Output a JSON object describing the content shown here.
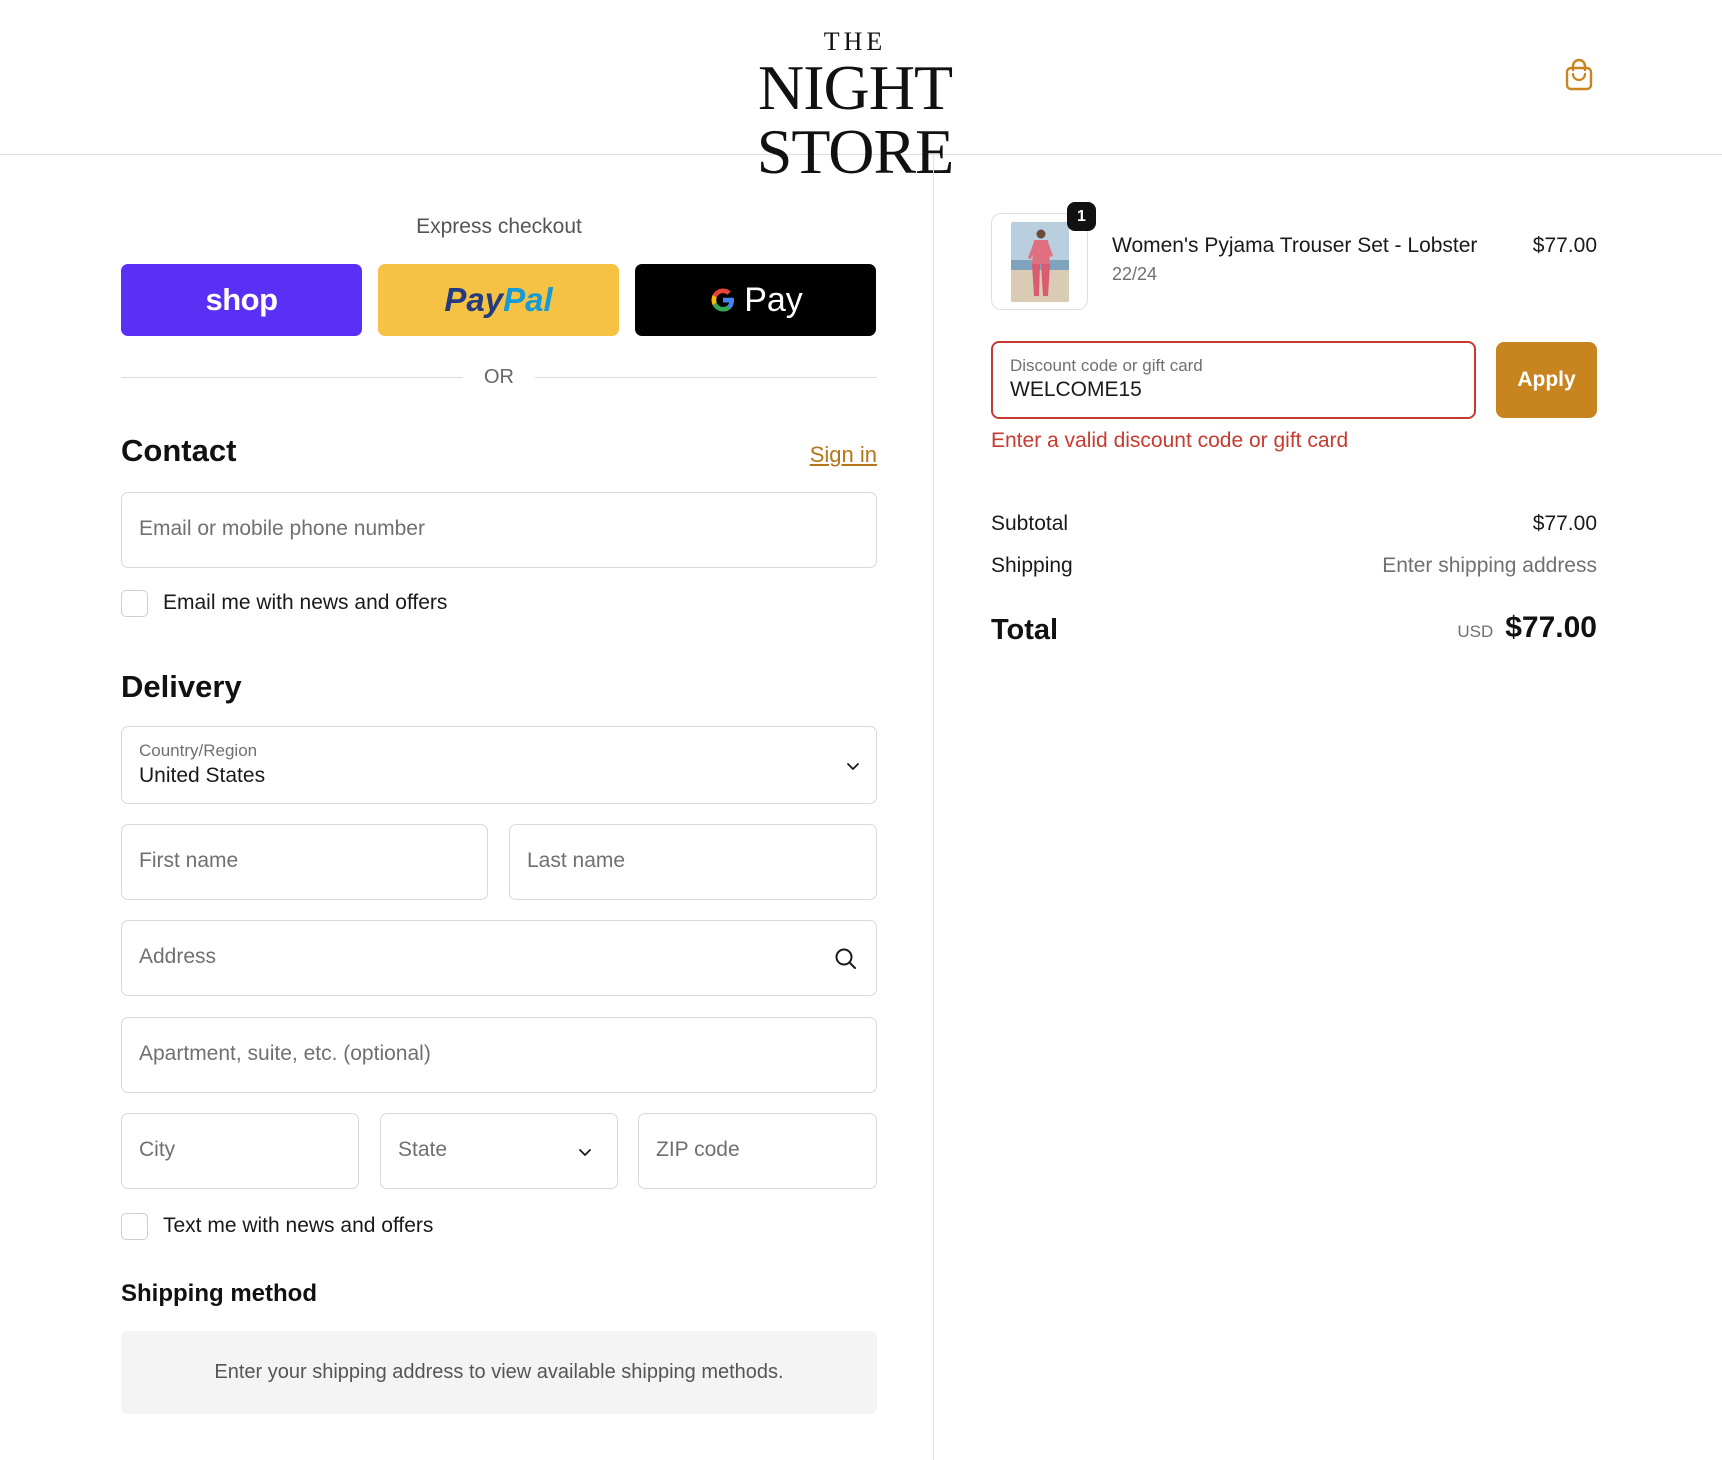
{
  "header": {
    "logo_top": "THE",
    "logo_main": "NIGHT STORE",
    "cart_icon": "shopping-bag-icon"
  },
  "express": {
    "title": "Express checkout",
    "shop_label": "shop",
    "paypal_part1": "Pay",
    "paypal_part2": "Pal",
    "gpay_label": "Pay",
    "or_label": "OR"
  },
  "contact": {
    "title": "Contact",
    "sign_in": "Sign in",
    "email_placeholder": "Email or mobile phone number",
    "news_checkbox_label": "Email me with news and offers"
  },
  "delivery": {
    "title": "Delivery",
    "country_label": "Country/Region",
    "country_value": "United States",
    "first_name_placeholder": "First name",
    "last_name_placeholder": "Last name",
    "address_placeholder": "Address",
    "apartment_placeholder": "Apartment, suite, etc. (optional)",
    "city_placeholder": "City",
    "state_placeholder": "State",
    "zip_placeholder": "ZIP code",
    "text_checkbox_label": "Text me with news and offers"
  },
  "shipping_method": {
    "title": "Shipping method",
    "note": "Enter your shipping address to view available shipping methods."
  },
  "order": {
    "quantity": "1",
    "product_name": "Women's Pyjama Trouser Set - Lobster",
    "variant": "22/24",
    "price": "$77.00",
    "discount_label": "Discount code or gift card",
    "discount_value": "WELCOME15",
    "apply_label": "Apply",
    "discount_error": "Enter a valid discount code or gift card",
    "subtotal_label": "Subtotal",
    "subtotal_value": "$77.00",
    "shipping_label": "Shipping",
    "shipping_value": "Enter shipping address",
    "total_label": "Total",
    "total_currency": "USD",
    "total_value": "$77.00"
  },
  "colors": {
    "shop_purple": "#5a31f4",
    "paypal_yellow": "#f5c244",
    "accent": "#c8841f",
    "error": "#c63a30"
  }
}
